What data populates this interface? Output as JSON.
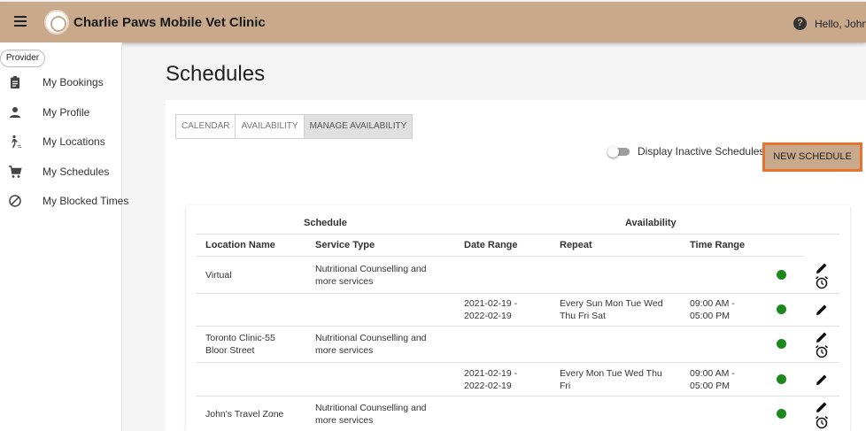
{
  "header": {
    "app_title": "Charlie Paws Mobile Vet Clinic",
    "greeting": "Hello, John",
    "brand_color": "#c8a98c"
  },
  "sidebar": {
    "role": "Provider",
    "items": [
      {
        "label": "My Bookings",
        "icon": "clipboard-icon"
      },
      {
        "label": "My Profile",
        "icon": "person-icon"
      },
      {
        "label": "My Locations",
        "icon": "walking-icon"
      },
      {
        "label": "My Schedules",
        "icon": "cart-icon"
      },
      {
        "label": "My Blocked Times",
        "icon": "block-icon"
      }
    ]
  },
  "main": {
    "title": "Schedules",
    "tabs": [
      {
        "label": "CALENDAR",
        "active": false
      },
      {
        "label": "AVAILABILITY",
        "active": false
      },
      {
        "label": "MANAGE AVAILABILITY",
        "active": true
      }
    ],
    "toggle_label": "Display Inactive Schedules",
    "new_button": "NEW SCHEDULE",
    "accent_color": "#e8732e"
  },
  "table": {
    "groups": [
      "Schedule",
      "Availability"
    ],
    "columns": [
      "Location Name",
      "Service Type",
      "Date Range",
      "Repeat",
      "Time Range"
    ],
    "rows": [
      {
        "location": "Virtual",
        "service": "Nutritional Counselling and more services",
        "date_range": "",
        "repeat": "",
        "time_range": "",
        "active": true,
        "has_alarm": true
      },
      {
        "location": "",
        "service": "",
        "date_range": "2021-02-19 - 2022-02-19",
        "repeat": "Every Sun Mon Tue Wed Thu Fri Sat",
        "time_range": "09:00 AM - 05:00 PM",
        "active": true,
        "has_alarm": false
      },
      {
        "location": "Toronto Clinic-55 Bloor Street",
        "service": "Nutritional Counselling and more services",
        "date_range": "",
        "repeat": "",
        "time_range": "",
        "active": true,
        "has_alarm": true
      },
      {
        "location": "",
        "service": "",
        "date_range": "2021-02-19 - 2022-02-19",
        "repeat": "Every Mon Tue Wed Thu Fri",
        "time_range": "09:00 AM - 05:00 PM",
        "active": true,
        "has_alarm": false
      },
      {
        "location": "John's Travel Zone",
        "service": "Nutritional Counselling and more services",
        "date_range": "",
        "repeat": "",
        "time_range": "",
        "active": true,
        "has_alarm": true
      }
    ],
    "status_color": "#1b8a1b"
  }
}
